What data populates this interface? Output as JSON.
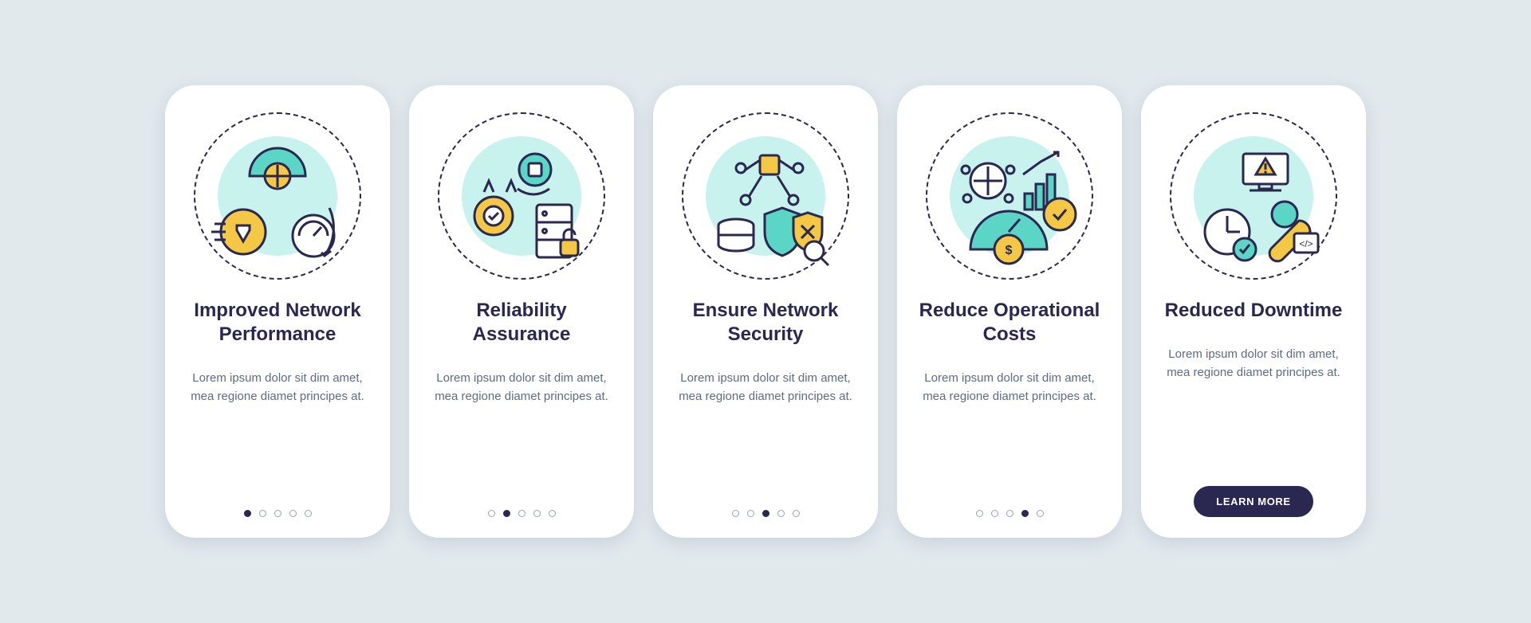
{
  "colors": {
    "navy": "#2a2750",
    "yellow": "#f4c745",
    "teal": "#5bd6c6",
    "mint": "#c7f2ee",
    "bg": "#e1e9ed",
    "body": "#5c6b86"
  },
  "cards": [
    {
      "id": "improved-network-performance",
      "title": "Improved Network Performance",
      "body": "Lorem ipsum dolor sit dim amet, mea regione diamet principes at.",
      "icon": "performance-gauges",
      "active_dot": 0,
      "cta": null
    },
    {
      "id": "reliability-assurance",
      "title": "Reliability Assurance",
      "body": "Lorem ipsum dolor sit dim amet, mea regione diamet principes at.",
      "icon": "reliability-server",
      "active_dot": 1,
      "cta": null
    },
    {
      "id": "ensure-network-security",
      "title": "Ensure Network Security",
      "body": "Lorem ipsum dolor sit dim amet, mea regione diamet principes at.",
      "icon": "security-shield",
      "active_dot": 2,
      "cta": null
    },
    {
      "id": "reduce-operational-costs",
      "title": "Reduce Operational Costs",
      "body": "Lorem ipsum dolor sit dim amet, mea regione diamet principes at.",
      "icon": "costs-gauge",
      "active_dot": 3,
      "cta": null
    },
    {
      "id": "reduced-downtime",
      "title": "Reduced Downtime",
      "body": "Lorem ipsum dolor sit dim amet, mea regione diamet principes at.",
      "icon": "downtime-wrench",
      "active_dot": null,
      "cta": "LEARN MORE"
    }
  ],
  "dot_count": 5
}
